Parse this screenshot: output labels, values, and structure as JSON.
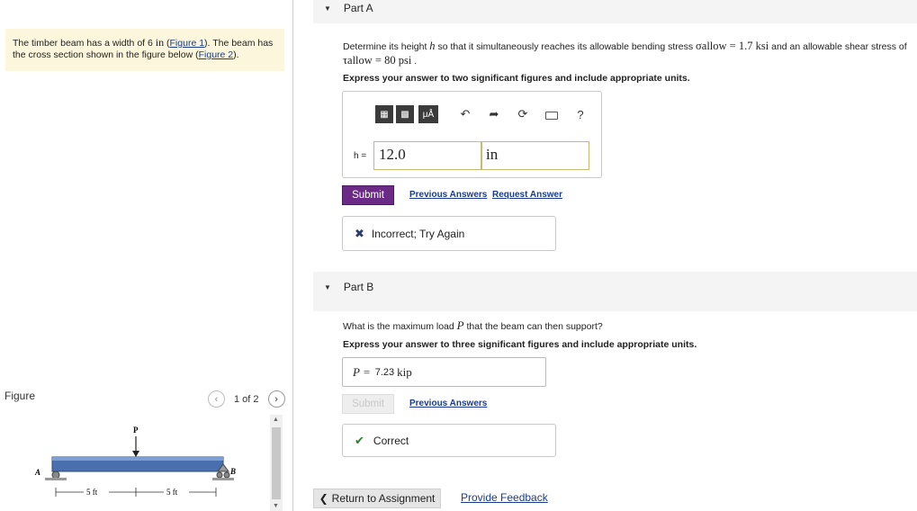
{
  "intro": {
    "text_before": "The timber beam has a width of 6 ",
    "unit": "in",
    "text_mid": " (",
    "link1": "Figure 1",
    "text_after": "). The beam has the cross section shown in the figure below (",
    "link2": "Figure 2",
    "text_end": ")."
  },
  "figure": {
    "title": "Figure",
    "count": "1 of 2",
    "prev_icon": "chevron-left-icon",
    "next_icon": "chevron-right-icon",
    "labels": {
      "P": "P",
      "A": "A",
      "B": "B",
      "dim1": "5 ft",
      "dim2": "5 ft"
    }
  },
  "partA": {
    "title": "Part A",
    "question_1": "Determine its height ",
    "h_var": "h",
    "question_2": " so that it simultaneously reaches its allowable bending stress ",
    "sigma_expr": "σallow = 1.7 ksi",
    "question_3": " and an allowable shear stress of",
    "tau_expr": "τallow = 80 psi",
    "question_4": " .",
    "instruction": "Express your answer to two significant figures and include appropriate units.",
    "toolbar": {
      "template_label": "",
      "mu_label": "μÅ",
      "help_label": "?"
    },
    "answer_label": "h =",
    "value": "12.0",
    "unit": "in",
    "submit": "Submit",
    "previous_answers": "Previous Answers",
    "request_answer": "Request Answer",
    "feedback": "Incorrect; Try Again"
  },
  "partB": {
    "title": "Part B",
    "question_1": "What is the maximum load ",
    "p_var": "P",
    "question_2": " that the beam can then support?",
    "instruction": "Express your answer to three significant figures and include appropriate units.",
    "answer_label": "P =",
    "value": "7.23",
    "unit": "kip",
    "submit": "Submit",
    "previous_answers": "Previous Answers",
    "feedback": "Correct"
  },
  "footer": {
    "return": "Return to Assignment",
    "feedback_link": "Provide Feedback"
  }
}
